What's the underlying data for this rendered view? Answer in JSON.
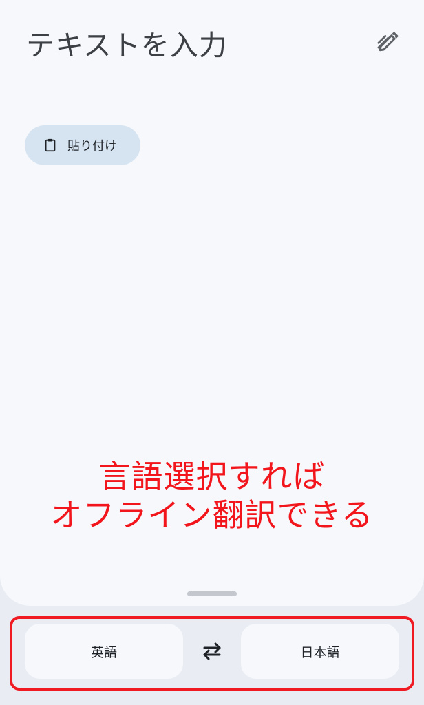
{
  "input": {
    "title": "テキストを入力",
    "handwriting_icon": "handwriting-pen-icon"
  },
  "paste_chip": {
    "label": "貼り付け",
    "icon": "clipboard-icon"
  },
  "annotation": {
    "line1": "言語選択すれば",
    "line2": "オフライン翻訳できる",
    "color": "#f2161c"
  },
  "language_bar": {
    "source_language": "英語",
    "target_language": "日本語",
    "swap_icon": "swap-arrows-icon",
    "highlight_color": "#ef1a22"
  },
  "colors": {
    "panel_background": "#f6f8fc",
    "chip_background": "#d6e4f1",
    "bottom_background": "#e9edf3"
  }
}
